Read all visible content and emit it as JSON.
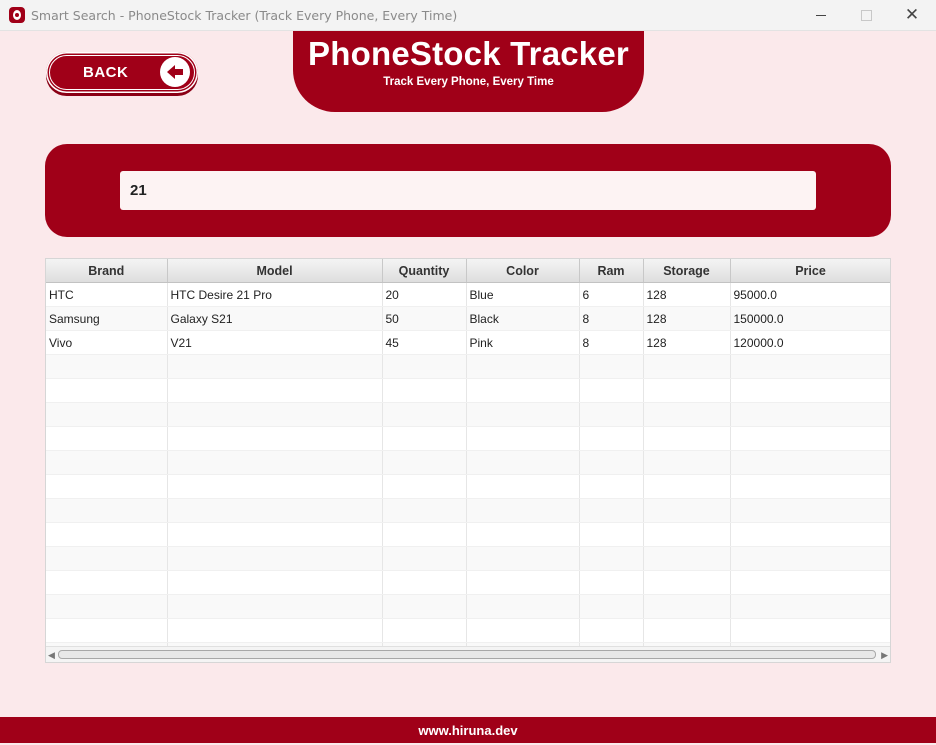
{
  "window": {
    "title": "Smart Search - PhoneStock Tracker (Track Every Phone, Every Time)",
    "minimize": "",
    "maximize": "",
    "close": "✕"
  },
  "back_button": {
    "label": "BACK",
    "icon": "arrow-left-circle-icon"
  },
  "header": {
    "title": "PhoneStock Tracker",
    "subtitle": "Track Every Phone, Every Time"
  },
  "search": {
    "value": "21"
  },
  "table": {
    "columns": [
      "Brand",
      "Model",
      "Quantity",
      "Color",
      "Ram",
      "Storage",
      "Price"
    ],
    "rows": [
      [
        "HTC",
        "HTC Desire 21 Pro",
        "20",
        "Blue",
        "6",
        "128",
        "95000.0"
      ],
      [
        "Samsung",
        "Galaxy S21",
        "50",
        "Black",
        "8",
        "128",
        "150000.0"
      ],
      [
        "Vivo",
        "V21",
        "45",
        "Pink",
        "8",
        "128",
        "120000.0"
      ]
    ]
  },
  "footer": {
    "text": "www.hiruna.dev"
  },
  "colors": {
    "accent": "#a00018",
    "background": "#fbe9eb"
  }
}
